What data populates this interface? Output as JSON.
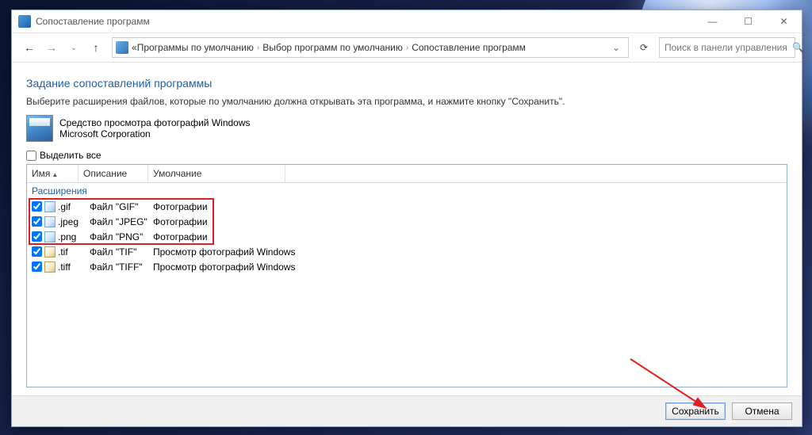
{
  "window": {
    "title": "Сопоставление программ"
  },
  "breadcrumb": {
    "lead": "«",
    "items": [
      "Программы по умолчанию",
      "Выбор программ по умолчанию",
      "Сопоставление программ"
    ]
  },
  "search": {
    "placeholder": "Поиск в панели управления"
  },
  "heading": "Задание сопоставлений программы",
  "description": "Выберите расширения файлов, которые по умолчанию должна открывать эта программа, и нажмите кнопку \"Сохранить\".",
  "program": {
    "name": "Средство просмотра фотографий Windows",
    "publisher": "Microsoft Corporation"
  },
  "select_all": "Выделить все",
  "columns": {
    "name": "Имя",
    "desc": "Описание",
    "default": "Умолчание"
  },
  "group_label": "Расширения",
  "rows": [
    {
      "ext": ".gif",
      "desc": "Файл \"GIF\"",
      "def": "Фотографии",
      "checked": true,
      "alt": false
    },
    {
      "ext": ".jpeg",
      "desc": "Файл \"JPEG\"",
      "def": "Фотографии",
      "checked": true,
      "alt": false
    },
    {
      "ext": ".png",
      "desc": "Файл \"PNG\"",
      "def": "Фотографии",
      "checked": true,
      "alt": false
    },
    {
      "ext": ".tif",
      "desc": "Файл \"TIF\"",
      "def": "Просмотр фотографий Windows",
      "checked": true,
      "alt": true
    },
    {
      "ext": ".tiff",
      "desc": "Файл \"TIFF\"",
      "def": "Просмотр фотографий Windows",
      "checked": true,
      "alt": true
    }
  ],
  "buttons": {
    "save": "Сохранить",
    "cancel": "Отмена"
  }
}
